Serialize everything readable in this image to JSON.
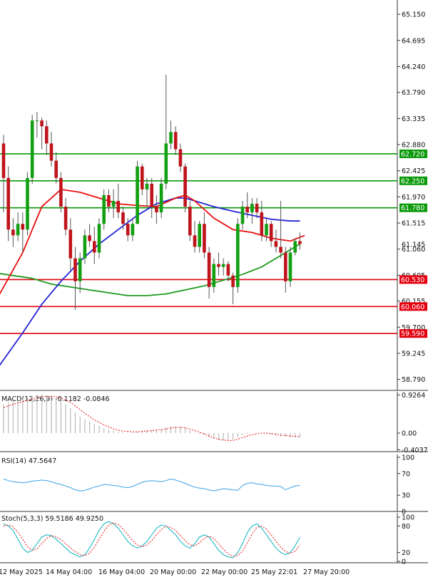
{
  "chart_data": [
    {
      "type": "candlestick",
      "ylim": [
        58.6,
        65.3
      ],
      "y_ticks": [
        "65.150",
        "64.695",
        "64.240",
        "63.790",
        "63.335",
        "62.880",
        "62.425",
        "61.970",
        "61.515",
        "61.060",
        "60.605",
        "60.155",
        "59.700",
        "59.245",
        "58.790"
      ],
      "x_labels": [
        "12 May 2025",
        "14 May 04:00",
        "16 May 04:00",
        "20 May 00:00",
        "22 May 00:00",
        "25 May 22:01",
        "27 May 20:00"
      ],
      "last_price": "61.145",
      "candles": [
        {
          "o": 62.9,
          "h": 63.05,
          "l": 61.7,
          "c": 62.3
        },
        {
          "o": 62.3,
          "h": 62.5,
          "l": 61.2,
          "c": 61.4
        },
        {
          "o": 61.4,
          "h": 61.6,
          "l": 61.1,
          "c": 61.3
        },
        {
          "o": 61.3,
          "h": 61.7,
          "l": 61.2,
          "c": 61.5
        },
        {
          "o": 61.5,
          "h": 61.7,
          "l": 61.0,
          "c": 61.4
        },
        {
          "o": 61.4,
          "h": 62.4,
          "l": 61.3,
          "c": 62.3
        },
        {
          "o": 62.3,
          "h": 63.4,
          "l": 62.2,
          "c": 63.3
        },
        {
          "o": 63.3,
          "h": 63.45,
          "l": 63.0,
          "c": 63.3
        },
        {
          "o": 63.3,
          "h": 63.35,
          "l": 62.8,
          "c": 63.2
        },
        {
          "o": 63.2,
          "h": 63.3,
          "l": 62.7,
          "c": 62.9
        },
        {
          "o": 62.9,
          "h": 63.1,
          "l": 62.5,
          "c": 62.6
        },
        {
          "o": 62.6,
          "h": 62.75,
          "l": 62.2,
          "c": 62.3
        },
        {
          "o": 62.3,
          "h": 62.4,
          "l": 61.7,
          "c": 61.8
        },
        {
          "o": 61.8,
          "h": 61.95,
          "l": 61.3,
          "c": 61.4
        },
        {
          "o": 61.4,
          "h": 61.6,
          "l": 60.7,
          "c": 60.9
        },
        {
          "o": 60.9,
          "h": 61.1,
          "l": 60.0,
          "c": 60.5
        },
        {
          "o": 60.5,
          "h": 61.0,
          "l": 60.3,
          "c": 60.9
        },
        {
          "o": 60.9,
          "h": 61.4,
          "l": 60.8,
          "c": 61.3
        },
        {
          "o": 61.3,
          "h": 61.5,
          "l": 61.1,
          "c": 61.2
        },
        {
          "o": 61.2,
          "h": 61.45,
          "l": 60.8,
          "c": 61.0
        },
        {
          "o": 61.0,
          "h": 61.6,
          "l": 60.9,
          "c": 61.5
        },
        {
          "o": 61.5,
          "h": 62.1,
          "l": 61.4,
          "c": 62.0
        },
        {
          "o": 62.0,
          "h": 62.1,
          "l": 61.7,
          "c": 61.8
        },
        {
          "o": 61.8,
          "h": 62.1,
          "l": 61.6,
          "c": 61.9
        },
        {
          "o": 61.9,
          "h": 62.2,
          "l": 61.6,
          "c": 61.7
        },
        {
          "o": 61.7,
          "h": 61.8,
          "l": 61.4,
          "c": 61.5
        },
        {
          "o": 61.5,
          "h": 61.6,
          "l": 61.2,
          "c": 61.3
        },
        {
          "o": 61.3,
          "h": 61.6,
          "l": 61.2,
          "c": 61.5
        },
        {
          "o": 61.5,
          "h": 62.6,
          "l": 61.5,
          "c": 62.5
        },
        {
          "o": 62.5,
          "h": 62.55,
          "l": 62.0,
          "c": 62.1
        },
        {
          "o": 62.1,
          "h": 62.3,
          "l": 61.8,
          "c": 62.2
        },
        {
          "o": 62.2,
          "h": 62.3,
          "l": 61.6,
          "c": 61.8
        },
        {
          "o": 61.8,
          "h": 62.0,
          "l": 61.5,
          "c": 61.7
        },
        {
          "o": 61.7,
          "h": 62.3,
          "l": 61.6,
          "c": 62.2
        },
        {
          "o": 62.2,
          "h": 64.1,
          "l": 62.1,
          "c": 62.9
        },
        {
          "o": 62.9,
          "h": 63.3,
          "l": 62.8,
          "c": 63.1
        },
        {
          "o": 63.1,
          "h": 63.2,
          "l": 62.7,
          "c": 62.8
        },
        {
          "o": 62.8,
          "h": 62.9,
          "l": 62.4,
          "c": 62.5
        },
        {
          "o": 62.5,
          "h": 62.55,
          "l": 61.7,
          "c": 61.8
        },
        {
          "o": 61.8,
          "h": 61.9,
          "l": 61.2,
          "c": 61.3
        },
        {
          "o": 61.3,
          "h": 61.55,
          "l": 61.0,
          "c": 61.1
        },
        {
          "o": 61.1,
          "h": 61.55,
          "l": 61.0,
          "c": 61.5
        },
        {
          "o": 61.5,
          "h": 61.7,
          "l": 60.9,
          "c": 61.0
        },
        {
          "o": 61.0,
          "h": 61.1,
          "l": 60.2,
          "c": 60.4
        },
        {
          "o": 60.4,
          "h": 60.9,
          "l": 60.3,
          "c": 60.8
        },
        {
          "o": 60.8,
          "h": 61.0,
          "l": 60.6,
          "c": 60.75
        },
        {
          "o": 60.75,
          "h": 60.9,
          "l": 60.6,
          "c": 60.8
        },
        {
          "o": 60.8,
          "h": 60.85,
          "l": 60.5,
          "c": 60.6
        },
        {
          "o": 60.6,
          "h": 60.65,
          "l": 60.1,
          "c": 60.4
        },
        {
          "o": 60.4,
          "h": 61.6,
          "l": 60.3,
          "c": 61.5
        },
        {
          "o": 61.5,
          "h": 61.9,
          "l": 61.4,
          "c": 61.8
        },
        {
          "o": 61.8,
          "h": 62.05,
          "l": 61.6,
          "c": 61.7
        },
        {
          "o": 61.7,
          "h": 61.95,
          "l": 61.5,
          "c": 61.85
        },
        {
          "o": 61.85,
          "h": 61.95,
          "l": 61.6,
          "c": 61.7
        },
        {
          "o": 61.7,
          "h": 61.9,
          "l": 61.2,
          "c": 61.3
        },
        {
          "o": 61.3,
          "h": 61.6,
          "l": 61.2,
          "c": 61.5
        },
        {
          "o": 61.5,
          "h": 61.55,
          "l": 61.1,
          "c": 61.2
        },
        {
          "o": 61.2,
          "h": 61.4,
          "l": 61.0,
          "c": 61.1
        },
        {
          "o": 61.1,
          "h": 61.9,
          "l": 60.9,
          "c": 61.0
        },
        {
          "o": 61.0,
          "h": 61.1,
          "l": 60.3,
          "c": 60.5
        },
        {
          "o": 60.5,
          "h": 61.1,
          "l": 60.4,
          "c": 61.0
        },
        {
          "o": 61.0,
          "h": 61.25,
          "l": 60.95,
          "c": 61.2
        },
        {
          "o": 61.2,
          "h": 61.35,
          "l": 61.05,
          "c": 61.15
        }
      ],
      "ma_red": [
        [
          -2,
          60.1
        ],
        [
          4,
          61.0
        ],
        [
          8,
          61.8
        ],
        [
          12,
          62.1
        ],
        [
          16,
          62.05
        ],
        [
          20,
          61.95
        ],
        [
          24,
          61.85
        ],
        [
          28,
          61.82
        ],
        [
          32,
          61.8
        ],
        [
          36,
          61.95
        ],
        [
          38,
          62.0
        ],
        [
          40,
          61.9
        ],
        [
          44,
          61.6
        ],
        [
          48,
          61.4
        ],
        [
          52,
          61.35
        ],
        [
          56,
          61.25
        ],
        [
          60,
          61.2
        ],
        [
          63,
          61.3
        ]
      ],
      "ma_blue": [
        [
          -2,
          58.9
        ],
        [
          4,
          59.6
        ],
        [
          8,
          60.1
        ],
        [
          12,
          60.5
        ],
        [
          16,
          60.85
        ],
        [
          20,
          61.15
        ],
        [
          24,
          61.4
        ],
        [
          28,
          61.65
        ],
        [
          32,
          61.85
        ],
        [
          36,
          61.95
        ],
        [
          38,
          61.95
        ],
        [
          40,
          61.9
        ],
        [
          44,
          61.8
        ],
        [
          48,
          61.72
        ],
        [
          52,
          61.65
        ],
        [
          56,
          61.58
        ],
        [
          60,
          61.55
        ],
        [
          62,
          61.55
        ]
      ],
      "ma_green": [
        [
          -2,
          60.65
        ],
        [
          2,
          60.6
        ],
        [
          6,
          60.55
        ],
        [
          10,
          60.45
        ],
        [
          14,
          60.4
        ],
        [
          18,
          60.35
        ],
        [
          22,
          60.3
        ],
        [
          26,
          60.25
        ],
        [
          30,
          60.25
        ],
        [
          34,
          60.28
        ],
        [
          38,
          60.35
        ],
        [
          42,
          60.42
        ],
        [
          46,
          60.52
        ],
        [
          50,
          60.62
        ],
        [
          54,
          60.75
        ],
        [
          58,
          60.95
        ],
        [
          60,
          61.05
        ],
        [
          62,
          61.15
        ]
      ],
      "hlines": [
        {
          "label": "62.720",
          "value": 62.72,
          "color": "#0a9a0a"
        },
        {
          "label": "62.250",
          "value": 62.25,
          "color": "#0a9a0a"
        },
        {
          "label": "61.780",
          "value": 61.78,
          "color": "#0a9a0a"
        },
        {
          "label": "60.530",
          "value": 60.53,
          "color": "#e3000f"
        },
        {
          "label": "60.060",
          "value": 60.06,
          "color": "#e3000f"
        },
        {
          "label": "59.590",
          "value": 59.59,
          "color": "#e3000f"
        }
      ]
    },
    {
      "type": "bar",
      "name": "MACD(12,26,9)",
      "header": "MACD(12,26,9) -0.1182 -0.0846",
      "ylim": [
        -0.45,
        0.95
      ],
      "y_ticks": [
        "0.9264",
        "0.00",
        "-0.4037"
      ],
      "histogram": [
        0.7,
        0.74,
        0.77,
        0.8,
        0.82,
        0.85,
        0.9,
        0.93,
        0.93,
        0.92,
        0.9,
        0.85,
        0.78,
        0.7,
        0.6,
        0.5,
        0.4,
        0.33,
        0.28,
        0.22,
        0.18,
        0.12,
        0.08,
        0.05,
        0.03,
        0.02,
        0.01,
        0.01,
        0.03,
        0.06,
        0.07,
        0.08,
        0.09,
        0.1,
        0.14,
        0.17,
        0.17,
        0.16,
        0.13,
        0.07,
        0.01,
        -0.02,
        -0.04,
        -0.1,
        -0.14,
        -0.17,
        -0.18,
        -0.17,
        -0.16,
        -0.1,
        -0.05,
        -0.02,
        0.0,
        0.01,
        0.0,
        -0.02,
        -0.04,
        -0.06,
        -0.08,
        -0.09,
        -0.1,
        -0.11,
        -0.12
      ],
      "signal": [
        0.62,
        0.66,
        0.7,
        0.73,
        0.76,
        0.79,
        0.82,
        0.85,
        0.88,
        0.89,
        0.89,
        0.88,
        0.85,
        0.8,
        0.74,
        0.66,
        0.57,
        0.48,
        0.4,
        0.32,
        0.26,
        0.2,
        0.15,
        0.1,
        0.07,
        0.05,
        0.04,
        0.03,
        0.03,
        0.04,
        0.05,
        0.06,
        0.07,
        0.08,
        0.1,
        0.12,
        0.14,
        0.14,
        0.13,
        0.1,
        0.06,
        0.02,
        -0.02,
        -0.07,
        -0.12,
        -0.15,
        -0.17,
        -0.18,
        -0.18,
        -0.15,
        -0.11,
        -0.07,
        -0.04,
        -0.02,
        0.0,
        0.0,
        -0.01,
        -0.03,
        -0.05,
        -0.06,
        -0.07,
        -0.08,
        -0.085
      ]
    },
    {
      "type": "line",
      "name": "RSI(14)",
      "header": "RSI(14) 47.5647",
      "ylim": [
        0,
        100
      ],
      "y_ticks": [
        "100",
        "70",
        "30",
        "0"
      ],
      "values": [
        60,
        57,
        55,
        54,
        53,
        54,
        56,
        57,
        58,
        57,
        55,
        52,
        50,
        47,
        44,
        40,
        38,
        39,
        42,
        45,
        47,
        50,
        49,
        48,
        47,
        45,
        44,
        46,
        50,
        54,
        56,
        57,
        56,
        55,
        57,
        60,
        58,
        55,
        52,
        48,
        45,
        43,
        42,
        40,
        38,
        40,
        42,
        41,
        40,
        39,
        48,
        52,
        53,
        51,
        50,
        48,
        47,
        47,
        46,
        40,
        44,
        47,
        48
      ]
    },
    {
      "type": "line",
      "name": "Stoch(5,3,3)",
      "header": "Stoch(5,3,3) 59.5186 49.9250",
      "ylim": [
        0,
        100
      ],
      "y_ticks": [
        "100",
        "80",
        "20",
        "0"
      ],
      "k": [
        85,
        80,
        70,
        50,
        30,
        20,
        25,
        40,
        55,
        60,
        58,
        50,
        40,
        30,
        20,
        15,
        10,
        15,
        30,
        50,
        70,
        85,
        90,
        85,
        75,
        60,
        45,
        35,
        30,
        35,
        45,
        60,
        75,
        82,
        80,
        70,
        60,
        45,
        35,
        30,
        40,
        55,
        60,
        55,
        40,
        25,
        15,
        10,
        8,
        20,
        40,
        65,
        80,
        85,
        75,
        60,
        45,
        30,
        20,
        15,
        20,
        35,
        55
      ],
      "d": [
        80,
        82,
        78,
        66,
        50,
        33,
        25,
        28,
        40,
        52,
        58,
        56,
        49,
        40,
        30,
        22,
        15,
        13,
        18,
        32,
        50,
        68,
        82,
        87,
        83,
        73,
        60,
        47,
        37,
        33,
        37,
        47,
        60,
        72,
        79,
        77,
        70,
        58,
        47,
        37,
        35,
        42,
        52,
        57,
        52,
        40,
        27,
        17,
        11,
        13,
        23,
        42,
        62,
        77,
        80,
        73,
        60,
        45,
        32,
        22,
        18,
        23,
        37
      ]
    }
  ]
}
